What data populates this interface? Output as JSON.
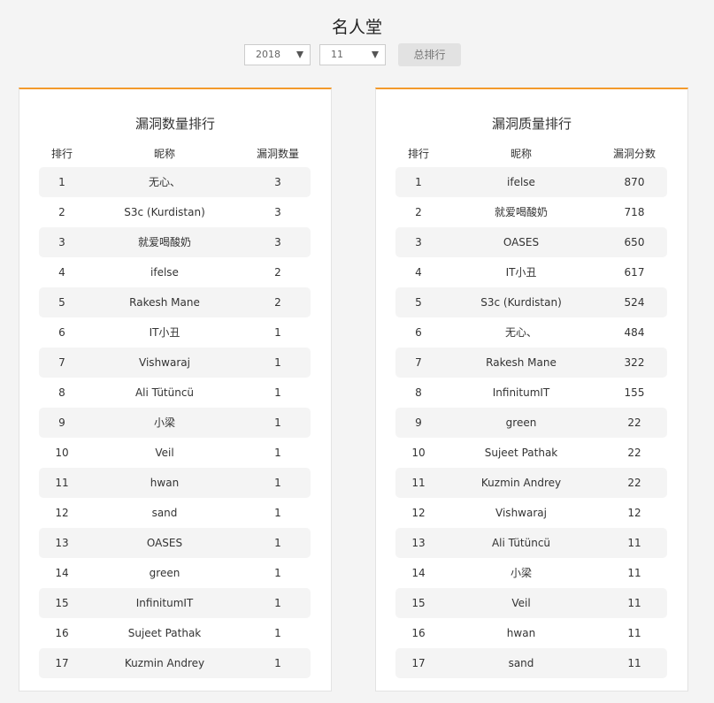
{
  "page": {
    "title": "名人堂"
  },
  "filters": {
    "year": "2018",
    "month": "11",
    "overall_rank_label": "总排行"
  },
  "count_board": {
    "title": "漏洞数量排行",
    "headers": {
      "rank": "排行",
      "name": "昵称",
      "value": "漏洞数量"
    },
    "rows": [
      {
        "rank": "1",
        "name": "无心、",
        "value": "3"
      },
      {
        "rank": "2",
        "name": "S3c (Kurdistan)",
        "value": "3"
      },
      {
        "rank": "3",
        "name": "就爱喝酸奶",
        "value": "3"
      },
      {
        "rank": "4",
        "name": "ifelse",
        "value": "2"
      },
      {
        "rank": "5",
        "name": "Rakesh Mane",
        "value": "2"
      },
      {
        "rank": "6",
        "name": "IT小丑",
        "value": "1"
      },
      {
        "rank": "7",
        "name": "Vishwaraj",
        "value": "1"
      },
      {
        "rank": "8",
        "name": "Ali Tütüncü",
        "value": "1"
      },
      {
        "rank": "9",
        "name": "小梁",
        "value": "1"
      },
      {
        "rank": "10",
        "name": "Veil",
        "value": "1"
      },
      {
        "rank": "11",
        "name": "hwan",
        "value": "1"
      },
      {
        "rank": "12",
        "name": "sand",
        "value": "1"
      },
      {
        "rank": "13",
        "name": "OASES",
        "value": "1"
      },
      {
        "rank": "14",
        "name": "green",
        "value": "1"
      },
      {
        "rank": "15",
        "name": "InfinitumIT",
        "value": "1"
      },
      {
        "rank": "16",
        "name": "Sujeet Pathak",
        "value": "1"
      },
      {
        "rank": "17",
        "name": "Kuzmin Andrey",
        "value": "1"
      }
    ]
  },
  "quality_board": {
    "title": "漏洞质量排行",
    "headers": {
      "rank": "排行",
      "name": "昵称",
      "value": "漏洞分数"
    },
    "rows": [
      {
        "rank": "1",
        "name": "ifelse",
        "value": "870"
      },
      {
        "rank": "2",
        "name": "就爱喝酸奶",
        "value": "718"
      },
      {
        "rank": "3",
        "name": "OASES",
        "value": "650"
      },
      {
        "rank": "4",
        "name": "IT小丑",
        "value": "617"
      },
      {
        "rank": "5",
        "name": "S3c (Kurdistan)",
        "value": "524"
      },
      {
        "rank": "6",
        "name": "无心、",
        "value": "484"
      },
      {
        "rank": "7",
        "name": "Rakesh Mane",
        "value": "322"
      },
      {
        "rank": "8",
        "name": "InfinitumIT",
        "value": "155"
      },
      {
        "rank": "9",
        "name": "green",
        "value": "22"
      },
      {
        "rank": "10",
        "name": "Sujeet Pathak",
        "value": "22"
      },
      {
        "rank": "11",
        "name": "Kuzmin Andrey",
        "value": "22"
      },
      {
        "rank": "12",
        "name": "Vishwaraj",
        "value": "12"
      },
      {
        "rank": "13",
        "name": "Ali Tütüncü",
        "value": "11"
      },
      {
        "rank": "14",
        "name": "小梁",
        "value": "11"
      },
      {
        "rank": "15",
        "name": "Veil",
        "value": "11"
      },
      {
        "rank": "16",
        "name": "hwan",
        "value": "11"
      },
      {
        "rank": "17",
        "name": "sand",
        "value": "11"
      }
    ]
  },
  "colors": {
    "accent": "#f39a2c",
    "row_alt": "#f4f4f4",
    "background": "#f4f4f4"
  },
  "icons": {
    "select_arrow": "chevron-down-icon"
  }
}
